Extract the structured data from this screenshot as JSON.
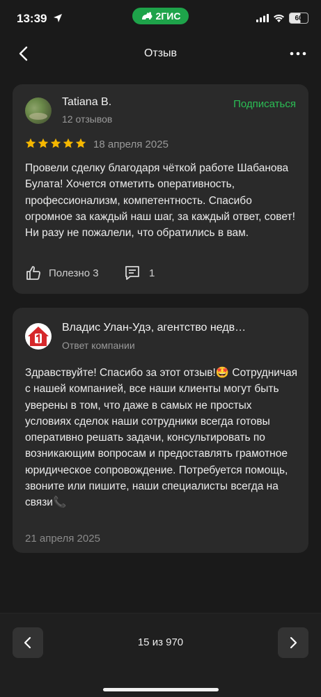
{
  "status_bar": {
    "time": "13:39",
    "brand": "2ГИС",
    "battery": "60"
  },
  "nav": {
    "title": "Отзыв"
  },
  "review": {
    "author": "Tatiana B.",
    "reviews_count": "12 отзывов",
    "subscribe_label": "Подписаться",
    "rating": 5,
    "date": "18 апреля 2025",
    "text": "Провели сделку благодаря чёткой работе Шабанова Булата! Хочется отметить оперативность, профессионализм, компетентность. Спасибо огромное за каждый наш шаг, за каждый ответ, совет! Ни разу не пожалели, что обратились в вам.",
    "useful_label": "Полезно 3",
    "comments_count": "1"
  },
  "reply": {
    "company": "Владис Улан-Удэ, агентство недв…",
    "subtitle": "Ответ компании",
    "text": "Здравствуйте! Спасибо за этот отзыв!🤩 Сотрудничая с нашей компанией, все наши клиенты могут быть уверены в том, что даже в самых не простых условиях сделок наши сотрудники всегда готовы оперативно решать задачи, консультировать по возникающим вопросам и предоставлять грамотное юридическое сопровождение. Потребуется помощь, звоните или пишите, наши специалисты всегда на связи📞",
    "date": "21 апреля 2025"
  },
  "pagination": {
    "label": "15 из 970"
  },
  "colors": {
    "accent": "#2bbf55",
    "brand_green": "#1ea34a",
    "star": "#f5b700",
    "logo_red": "#d6282b"
  }
}
